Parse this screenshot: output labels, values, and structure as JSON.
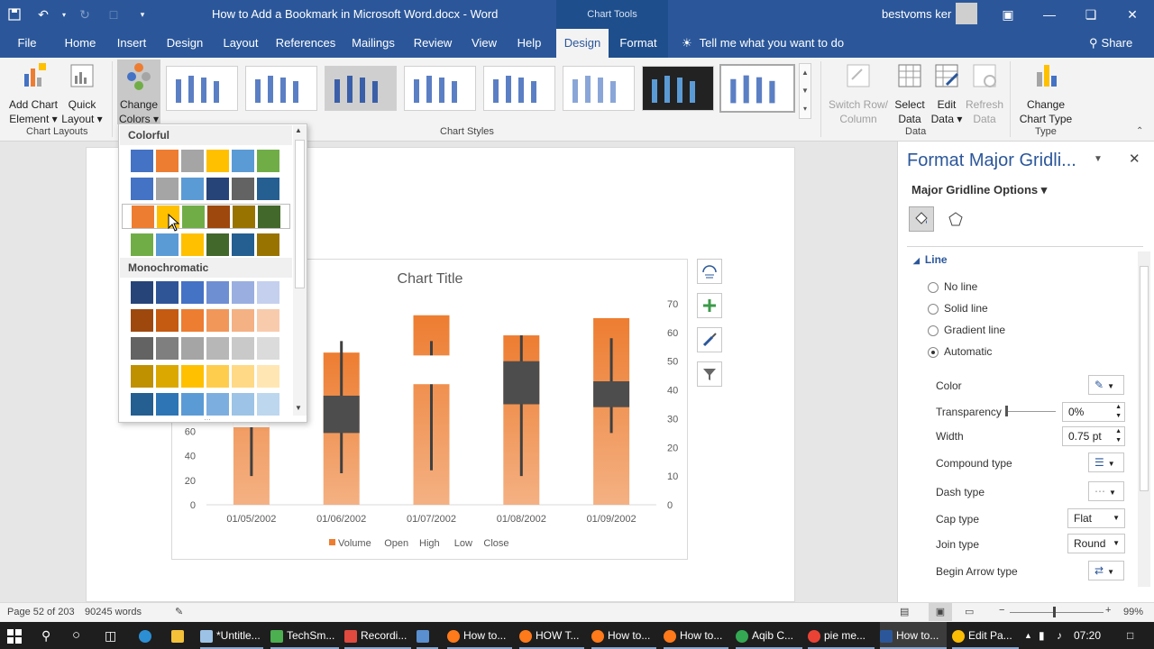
{
  "titlebar": {
    "document_title": "How to Add a Bookmark in Microsoft Word.docx  -  Word",
    "contextual_group": "Chart Tools",
    "user_name": "bestvoms ker"
  },
  "tabs": [
    "File",
    "Home",
    "Insert",
    "Design",
    "Layout",
    "References",
    "Mailings",
    "Review",
    "View",
    "Help",
    "Design",
    "Format"
  ],
  "active_tab": "Design",
  "tell_me": "Tell me what you want to do",
  "share": "Share",
  "ribbon": {
    "add_chart_element": [
      "Add Chart",
      "Element ▾"
    ],
    "quick_layout": [
      "Quick",
      "Layout ▾"
    ],
    "change_colors": [
      "Change",
      "Colors ▾"
    ],
    "switch_row_column": [
      "Switch Row/",
      "Column"
    ],
    "select_data": [
      "Select",
      "Data"
    ],
    "edit_data": [
      "Edit",
      "Data ▾"
    ],
    "refresh_data": [
      "Refresh",
      "Data"
    ],
    "change_chart_type": [
      "Change",
      "Chart Type"
    ],
    "groups": {
      "chart_layouts": "Chart Layouts",
      "chart_styles": "Chart Styles",
      "data": "Data",
      "type": "Type"
    }
  },
  "colors_dropdown": {
    "colorful_label": "Colorful",
    "monochromatic_label": "Monochromatic",
    "colorful_rows": [
      [
        "#4472c4",
        "#ed7d31",
        "#a5a5a5",
        "#ffc000",
        "#5b9bd5",
        "#70ad47"
      ],
      [
        "#4472c4",
        "#a5a5a5",
        "#5b9bd5",
        "#264478",
        "#636363",
        "#255e91"
      ],
      [
        "#ed7d31",
        "#ffc000",
        "#70ad47",
        "#9e480e",
        "#997300",
        "#43682b"
      ],
      [
        "#70ad47",
        "#5b9bd5",
        "#ffc000",
        "#43682b",
        "#255e91",
        "#997300"
      ]
    ],
    "mono_rows": [
      [
        "#264478",
        "#2f5597",
        "#4472c4",
        "#6f8fd3",
        "#9aafe0",
        "#c5d0ee"
      ],
      [
        "#9e480e",
        "#c55a11",
        "#ed7d31",
        "#f1975a",
        "#f4b183",
        "#f8cbad"
      ],
      [
        "#636363",
        "#7f7f7f",
        "#a5a5a5",
        "#b7b7b7",
        "#c9c9c9",
        "#dbdbdb"
      ],
      [
        "#bf9000",
        "#dba800",
        "#ffc000",
        "#ffcd4d",
        "#ffd985",
        "#ffe6b3"
      ],
      [
        "#255e91",
        "#2e75b6",
        "#5b9bd5",
        "#7daee0",
        "#9dc3e6",
        "#bdd7ee"
      ]
    ]
  },
  "chart_data": {
    "type": "bar",
    "title": "Chart Title",
    "categories": [
      "01/05/2002",
      "01/06/2002",
      "01/07/2002",
      "01/08/2002",
      "01/09/2002"
    ],
    "series": [
      {
        "name": "Volume",
        "values": [
          80,
          53,
          66,
          59,
          65
        ]
      },
      {
        "name": "Open",
        "values": [
          27,
          38,
          42,
          50,
          43
        ]
      },
      {
        "name": "High",
        "values": [
          34,
          57,
          57,
          59,
          58
        ]
      },
      {
        "name": "Low",
        "values": [
          10,
          11,
          12,
          10,
          25
        ]
      },
      {
        "name": "Close",
        "values": [
          30,
          25,
          52,
          35,
          34
        ]
      }
    ],
    "left_axis_ticks": [
      "0",
      "20",
      "40",
      "60"
    ],
    "right_axis_ticks": [
      "0",
      "10",
      "20",
      "30",
      "40",
      "50",
      "60",
      "70"
    ],
    "ylim_right": [
      0,
      70
    ],
    "legend": [
      "Volume",
      "Open",
      "High",
      "Low",
      "Close"
    ],
    "legend_position": "bottom",
    "colors": {
      "volume": "#ed7d31",
      "up": "#ffffff",
      "down": "#4d4d4d",
      "wick": "#404040"
    }
  },
  "pane": {
    "title": "Format Major Gridli...",
    "options_label": "Major Gridline Options ▾",
    "section": "Line",
    "radios": [
      "No line",
      "Solid line",
      "Gradient line",
      "Automatic"
    ],
    "selected_radio": "Automatic",
    "color_label": "Color",
    "transparency_label": "Transparency",
    "transparency_value": "0%",
    "width_label": "Width",
    "width_value": "0.75 pt",
    "compound_label": "Compound type",
    "dash_label": "Dash type",
    "cap_label": "Cap type",
    "cap_value": "Flat",
    "join_label": "Join type",
    "join_value": "Round",
    "begin_arrow_label": "Begin Arrow type"
  },
  "status": {
    "page": "Page 52 of 203",
    "words": "90245 words",
    "zoom": "99%"
  },
  "taskbar": {
    "items": [
      "*Untitle...",
      "TechSm...",
      "Recordi...",
      "",
      "How to...",
      "HOW T...",
      "How to...",
      "How to...",
      "Aqib C...",
      "pie me...",
      "How to...",
      "Edit Pa..."
    ],
    "time": "07:20"
  }
}
